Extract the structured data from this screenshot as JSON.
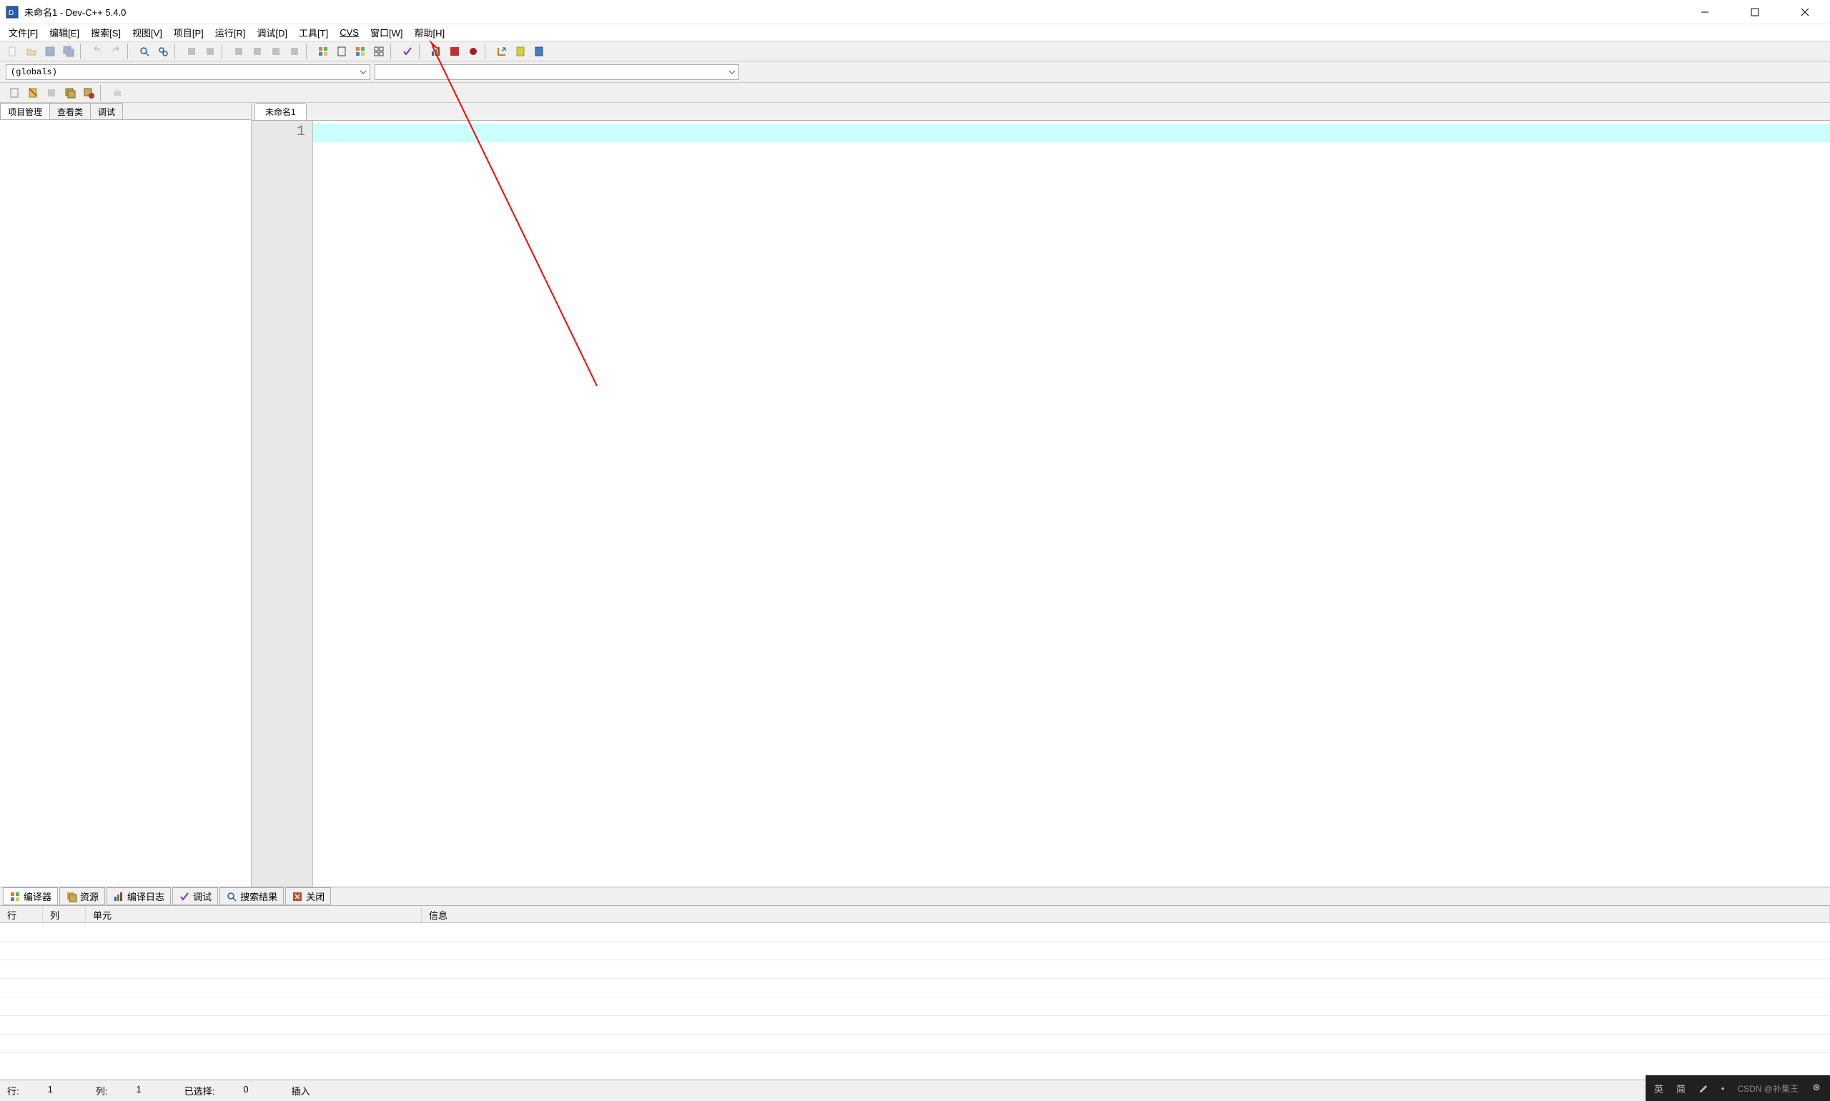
{
  "title": "未命名1 - Dev-C++ 5.4.0",
  "menu": {
    "file": "文件[F]",
    "edit": "编辑[E]",
    "search": "搜索[S]",
    "view": "视图[V]",
    "project": "项目[P]",
    "run": "运行[R]",
    "debug": "调试[D]",
    "tools": "工具[T]",
    "cvs": "CVS",
    "window": "窗口[W]",
    "help": "帮助[H]"
  },
  "combo": {
    "globals": "(globals)"
  },
  "left_tabs": {
    "project": "项目管理",
    "class": "查看类",
    "debug": "调试"
  },
  "editor": {
    "tab1": "未命名1",
    "line1": "1"
  },
  "bottom_tabs": {
    "compiler": "编译器",
    "resource": "资源",
    "compilelog": "编译日志",
    "debug": "调试",
    "search": "搜索结果",
    "close": "关闭"
  },
  "grid_headers": {
    "line": "行",
    "col": "列",
    "unit": "单元",
    "message": "信息"
  },
  "status": {
    "line_label": "行:",
    "line_val": "1",
    "col_label": "列:",
    "col_val": "1",
    "sel_label": "已选择:",
    "sel_val": "0",
    "mode": "插入"
  },
  "ime": {
    "lang": "英",
    "mode": "简",
    "watermark": "CSDN @补集王"
  }
}
